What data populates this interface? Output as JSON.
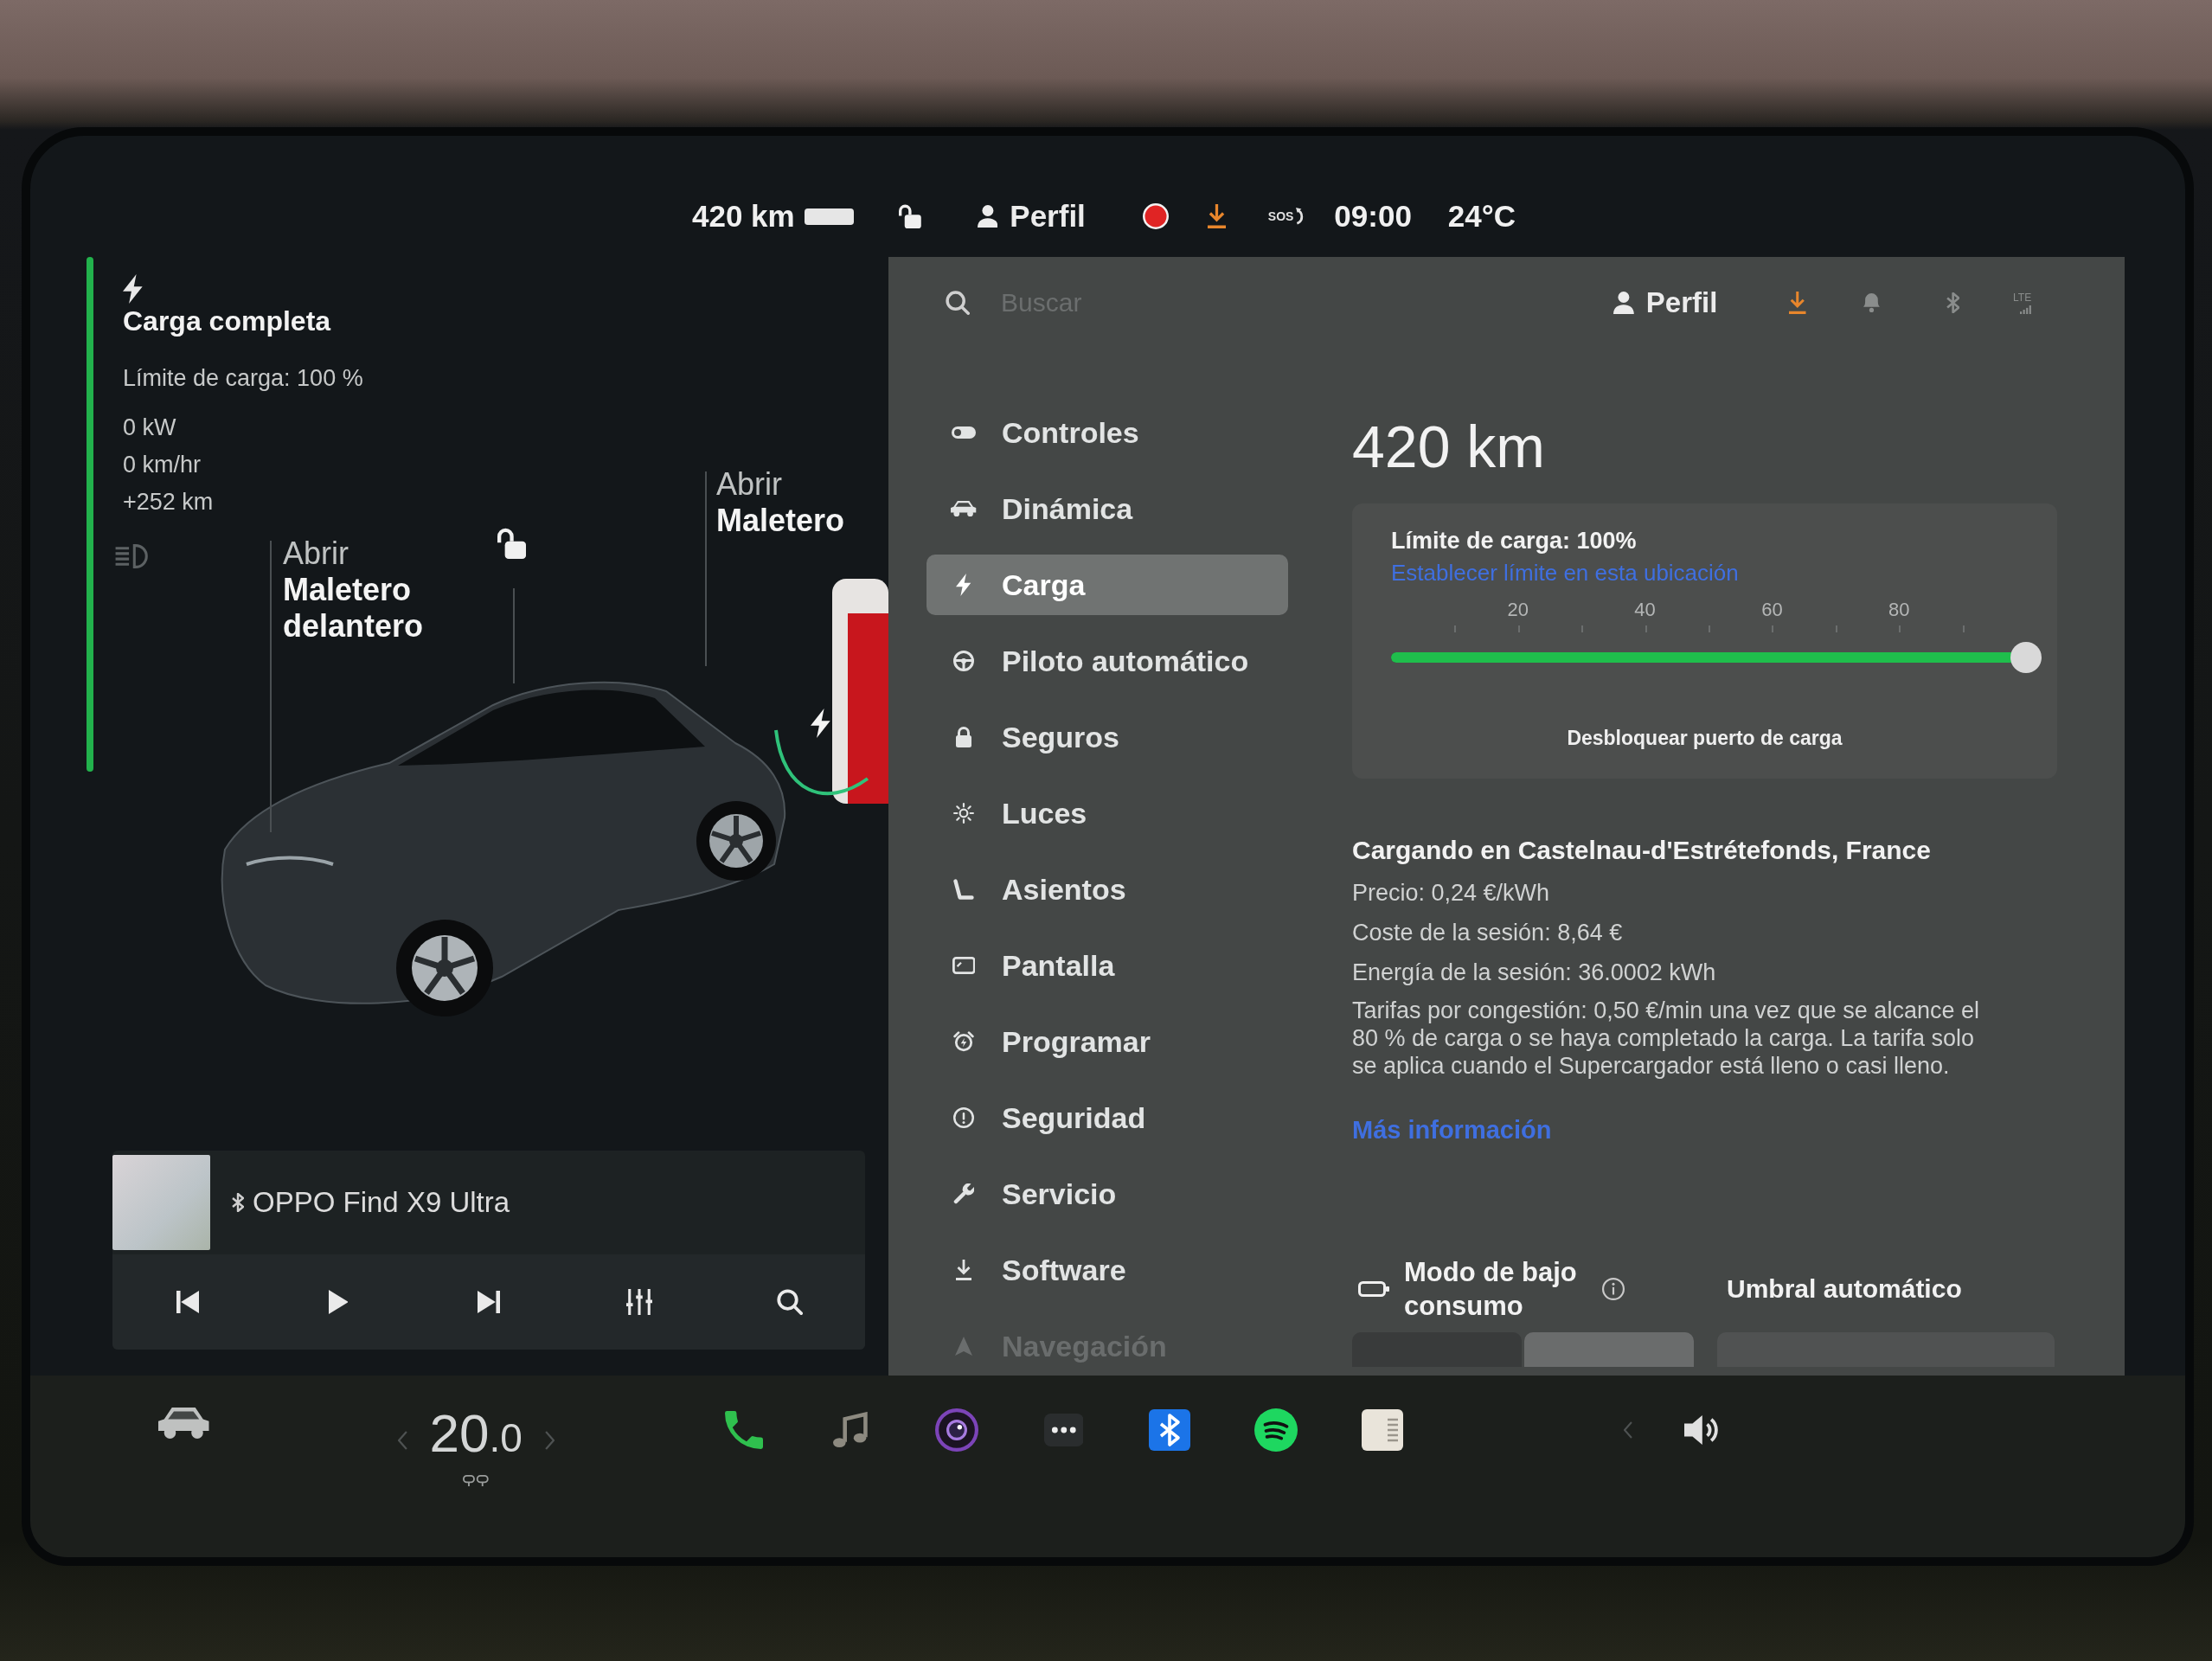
{
  "status_bar": {
    "range": "420 km",
    "profile": "Perfil",
    "emergency": "SOS",
    "time": "09:00",
    "temperature": "24°C"
  },
  "charge_status": {
    "title": "Carga completa",
    "limit": "Límite de carga: 100 %",
    "stats": [
      "0 kW",
      "0 km/hr",
      "+252 km"
    ]
  },
  "car_view": {
    "labels": [
      {
        "action": "Abrir",
        "target": "Maletero delantero"
      },
      {
        "action": "Abrir",
        "target": "Maletero"
      }
    ]
  },
  "media": {
    "device": "OPPO Find X9 Ultra"
  },
  "settings": {
    "search": {
      "placeholder": "Buscar"
    },
    "profile": "Perfil",
    "network": "LTE",
    "menu": [
      {
        "label": "Controles",
        "selected": false
      },
      {
        "label": "Dinámica",
        "selected": false
      },
      {
        "label": "Carga",
        "selected": true
      },
      {
        "label": "Piloto automático",
        "selected": false
      },
      {
        "label": "Seguros",
        "selected": false
      },
      {
        "label": "Luces",
        "selected": false
      },
      {
        "label": "Asientos",
        "selected": false
      },
      {
        "label": "Pantalla",
        "selected": false
      },
      {
        "label": "Programar",
        "selected": false
      },
      {
        "label": "Seguridad",
        "selected": false
      },
      {
        "label": "Servicio",
        "selected": false
      },
      {
        "label": "Software",
        "selected": false
      },
      {
        "label": "Navegación",
        "selected": false
      }
    ],
    "charging": {
      "range": "420 km",
      "limit_card": {
        "label": "Límite de carga: 100%",
        "link": "Establecer límite en esta ubicación",
        "ticks": [
          "20",
          "40",
          "60",
          "80"
        ],
        "level": 1,
        "unlock": "Desbloquear puerto de carga"
      },
      "session": {
        "title": "Cargando en Castelnau-d'Estrétefonds, France",
        "details": [
          "Precio: 0,24 €/kWh",
          "Coste de la sesión: 8,64 €",
          "Energía de la sesión: 36.0002 kWh"
        ],
        "note": "Tarifas por congestión: 0,50 €/min una vez que se alcance el 80 % de carga o se haya completado la carga. La tarifa solo se aplica cuando el Supercargador está lleno o casi lleno.",
        "link": "Más información"
      },
      "low_power": {
        "label": "Modo de bajo consumo",
        "segments": [
          {
            "selected": false
          },
          {
            "selected": true
          }
        ]
      },
      "threshold": {
        "label": "Umbral automático"
      }
    }
  },
  "bottom_bar": {
    "cabin_temperature": "20.0"
  }
}
